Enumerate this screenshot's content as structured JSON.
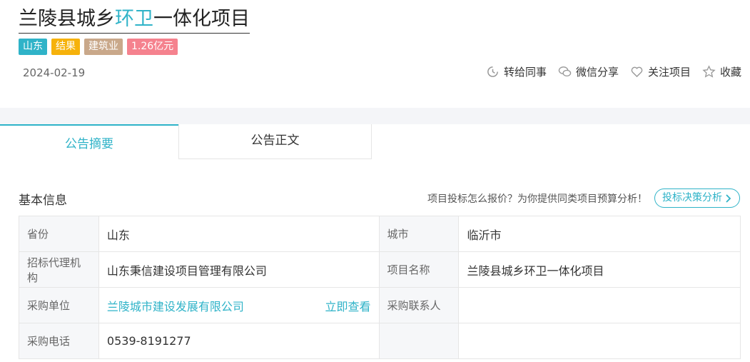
{
  "title": {
    "part1": "兰陵县城乡",
    "part2": "环卫",
    "part3": "一体化项目"
  },
  "tags": [
    {
      "label": "山东",
      "color": "#2fb3c8"
    },
    {
      "label": "结果",
      "color": "#f6b20b"
    },
    {
      "label": "建筑业",
      "color": "#c9a88a"
    },
    {
      "label": "1.26亿元",
      "color": "#f5828e"
    }
  ],
  "date": "2024-02-19",
  "actions": [
    {
      "label": "转给同事",
      "icon": "forward-icon"
    },
    {
      "label": "微信分享",
      "icon": "wechat-icon"
    },
    {
      "label": "关注项目",
      "icon": "heart-icon"
    },
    {
      "label": "收藏",
      "icon": "star-icon"
    }
  ],
  "tabs": [
    {
      "label": "公告摘要"
    },
    {
      "label": "公告正文"
    }
  ],
  "section": {
    "title": "基本信息",
    "promo_text": "项目投标怎么报价？为你提供同类项目预算分析！",
    "promo_button": "投标决策分析"
  },
  "info": {
    "province_label": "省份",
    "province": "山东",
    "city_label": "城市",
    "city": "临沂市",
    "agency_label": "招标代理机构",
    "agency": "山东秉信建设项目管理有限公司",
    "project_label": "项目名称",
    "project": "兰陵县城乡环卫一体化项目",
    "buyer_label": "采购单位",
    "buyer": "兰陵城市建设发展有限公司",
    "buyer_link": "立即查看",
    "contact_label": "采购联系人",
    "contact": "",
    "phone_label": "采购电话",
    "phone": "0539-8191277"
  }
}
